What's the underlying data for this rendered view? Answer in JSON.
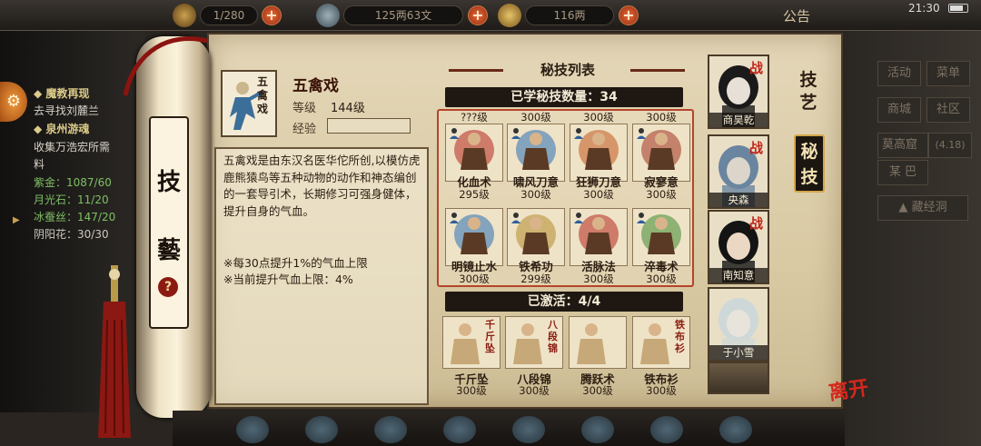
{
  "topbar": {
    "storage": "1/280",
    "copper": "125两63文",
    "silver": "116两",
    "announce": "公告",
    "time": "21:30"
  },
  "quest": {
    "lines": [
      {
        "text": "◆ 魔教再现",
        "type": "title"
      },
      {
        "text": "去寻找刘麓兰",
        "type": "sub"
      },
      {
        "text": "◆ 泉州游魂",
        "type": "title"
      },
      {
        "text": "收集万浩宏所需",
        "type": "sub"
      },
      {
        "text": "料",
        "type": "sub"
      },
      {
        "text": "紫金：1087/60",
        "type": "stat"
      },
      {
        "text": "月光石：11/20",
        "type": "stat"
      },
      {
        "text": "冰蚕丝：147/20",
        "type": "stat"
      },
      {
        "text": "阴阳花：30/30",
        "type": "stat2"
      }
    ]
  },
  "roller": {
    "char1": "技",
    "char2": "藝",
    "help": "?"
  },
  "skill": {
    "icon_text": "五禽戏",
    "name": "五禽戏",
    "level_label": "等级",
    "level_value": "144级",
    "exp_label": "经验",
    "description": "五禽戏是由东汉名医华佗所创,以模仿虎鹿熊猿鸟等五种动物的动作和神态编创的一套导引术，长期修习可强身健体，提升自身的气血。",
    "note1": "※每30点提升1%的气血上限",
    "note2": "※当前提升气血上限：4%"
  },
  "list": {
    "title": "秘技列表",
    "learned": "已学秘技数量：34",
    "activated": "已激活：4/4",
    "row_top_partial": [
      "???级",
      "300级",
      "300级",
      "300级"
    ],
    "learned_skills": [
      {
        "name": "化血术",
        "level": "295级",
        "color": "#b3261e"
      },
      {
        "name": "啸风刀意",
        "level": "300级",
        "color": "#2c6fb3"
      },
      {
        "name": "狂狮刀意",
        "level": "300级",
        "color": "#c2581e"
      },
      {
        "name": "寂寥意",
        "level": "300级",
        "color": "#a1311f"
      },
      {
        "name": "明镜止水",
        "level": "300级",
        "color": "#2c6fb3"
      },
      {
        "name": "铁希功",
        "level": "299级",
        "color": "#b38a2c"
      },
      {
        "name": "活脉法",
        "level": "300级",
        "color": "#b3261e"
      },
      {
        "name": "淬毒术",
        "level": "300级",
        "color": "#3c8a2e"
      }
    ],
    "active_skills": [
      {
        "name": "千斤坠",
        "level": "300级",
        "tag": "千斤坠"
      },
      {
        "name": "八段锦",
        "level": "300级",
        "tag": "八段锦"
      },
      {
        "name": "腾跃术",
        "level": "300级",
        "tag": ""
      },
      {
        "name": "铁布衫",
        "level": "300级",
        "tag": "铁布衫"
      }
    ]
  },
  "portraits": [
    {
      "name": "商昊乾",
      "battle": "战"
    },
    {
      "name": "央森",
      "battle": "战"
    },
    {
      "name": "南知意",
      "battle": "战"
    },
    {
      "name": "于小雪",
      "battle": ""
    }
  ],
  "tabs": {
    "jiyi": "技艺",
    "miji": "秘技"
  },
  "right_panel": {
    "buttons": [
      "活动",
      "菜单",
      "商城",
      "社区"
    ],
    "location": "莫高窟",
    "coords": "(4.18)",
    "sub": "某 巴",
    "dungeon": "藏经洞"
  },
  "leave": "离开"
}
